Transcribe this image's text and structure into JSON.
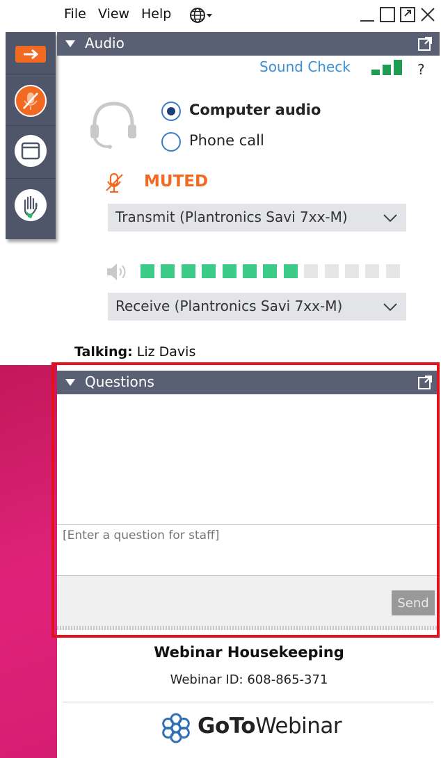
{
  "menu": {
    "file": "File",
    "view": "View",
    "help": "Help"
  },
  "colors": {
    "accent": "#f26a22",
    "meter_on": "#3dcb8a",
    "meter_off": "#e6e6e6",
    "header": "#5a6074",
    "highlight_border": "#e3111b"
  },
  "icons": {
    "globe": "globe-icon",
    "minimize": "minimize-icon",
    "maximize": "maximize-icon",
    "restore": "restore-icon",
    "close": "close-icon",
    "arrow": "arrow-right-icon",
    "mic_muted": "microphone-muted-icon",
    "window": "window-icon",
    "hand": "raise-hand-icon",
    "headset": "headset-icon",
    "speaker": "speaker-icon",
    "popout": "popout-icon",
    "logo": "gotowebinar-logo-icon",
    "signal": "signal-bars-icon"
  },
  "audio": {
    "title": "Audio",
    "sound_check": "Sound Check",
    "help": "?",
    "signal_bars": 3,
    "options": [
      {
        "label": "Computer audio",
        "selected": true
      },
      {
        "label": "Phone call",
        "selected": false
      }
    ],
    "status": "MUTED",
    "transmit": "Transmit (Plantronics Savi 7xx-M)",
    "receive": "Receive (Plantronics Savi 7xx-M)",
    "volume": {
      "filled": 8,
      "total": 13
    }
  },
  "talking": {
    "label": "Talking:",
    "name": "Liz Davis"
  },
  "questions": {
    "title": "Questions",
    "placeholder": "[Enter a question for staff]",
    "send": "Send"
  },
  "footer": {
    "title": "Webinar Housekeeping",
    "webinar_id": "Webinar ID: 608-865-371",
    "brand_bold": "GoTo",
    "brand_light": "Webinar"
  }
}
